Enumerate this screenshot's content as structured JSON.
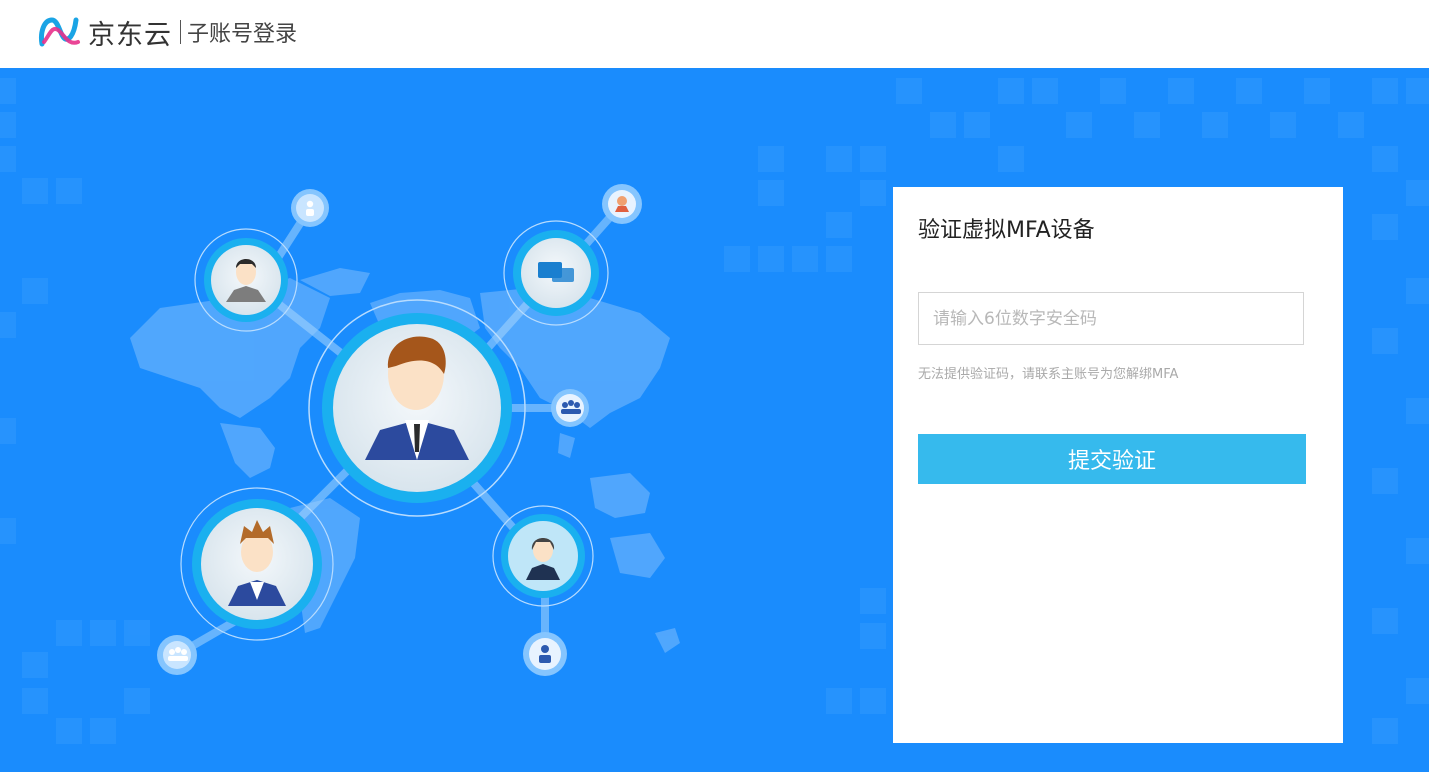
{
  "header": {
    "brand": "京东云",
    "subtitle": "子账号登录"
  },
  "colors": {
    "hero_bg": "#1a8cfd",
    "button": "#36baed",
    "logo_pink": "#e8318b",
    "logo_blue": "#1aa4e5"
  },
  "illustration": {
    "icons": [
      "world-map",
      "businessman-avatar",
      "user-avatar",
      "chat-bubble-icon",
      "group-icon",
      "woman-avatar",
      "person-icon"
    ]
  },
  "mfa": {
    "title": "验证虚拟MFA设备",
    "code_placeholder": "请输入6位数字安全码",
    "code_value": "",
    "hint": "无法提供验证码，请联系主账号为您解绑MFA",
    "submit_label": "提交验证"
  }
}
